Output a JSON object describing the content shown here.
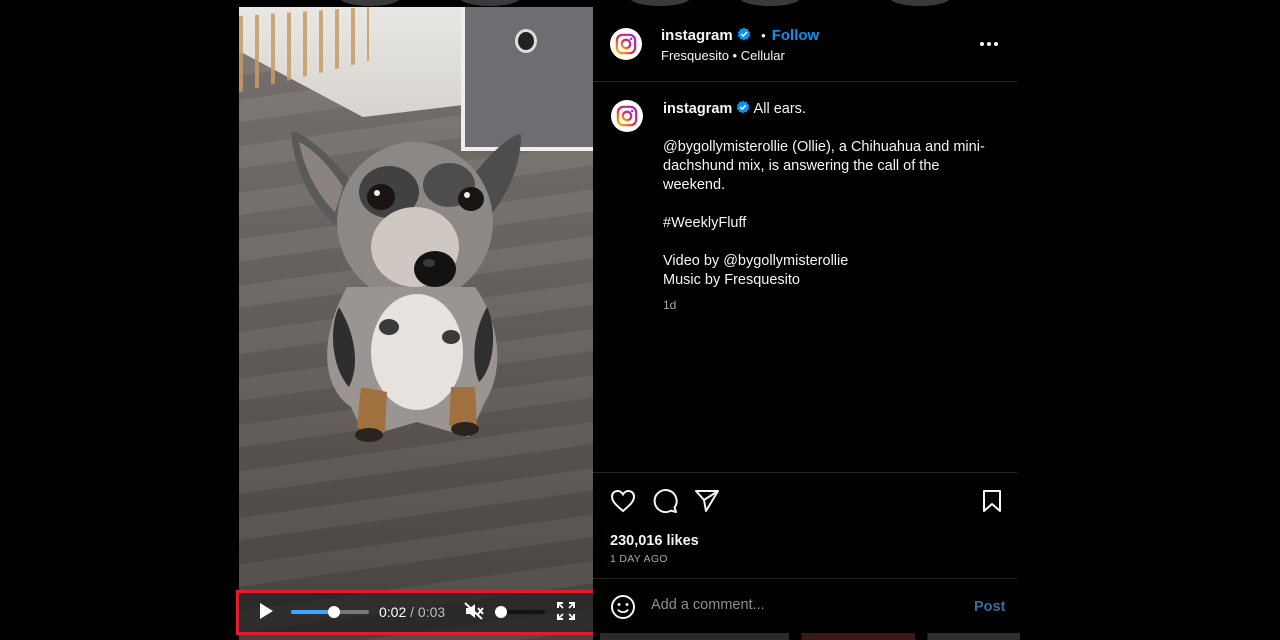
{
  "media": {
    "controls": {
      "current_time": "0:02",
      "separator": " / ",
      "total_time": "0:03",
      "progress_fraction": 0.55,
      "volume_fraction": 0.0,
      "muted": true
    }
  },
  "post": {
    "header": {
      "username": "instagram",
      "follow_label": "Follow",
      "audio_artist": "Fresquesito",
      "audio_separator": "•",
      "audio_track": "Cellular"
    },
    "caption": {
      "username": "instagram",
      "lead": "All ears.",
      "line1": "@bygollymisterollie (Ollie), a Chihuahua and mini-dachshund mix, is answering the call of the weekend.",
      "hashtag": "#WeeklyFluff",
      "credit_video": "Video by @bygollymisterollie",
      "credit_music": "Music by Fresquesito",
      "age_short": "1d"
    },
    "likes": "230,016 likes",
    "age_full": "1 DAY AGO",
    "comment": {
      "placeholder": "Add a comment...",
      "post_label": "Post"
    }
  },
  "colors": {
    "accent_blue": "#0095f6",
    "highlight_red": "#e41b2f",
    "progress_blue": "#3ea6ff",
    "post_button": "#3d6d9c"
  },
  "icons": [
    "instagram-logo-icon",
    "verified-badge-icon",
    "more-options-icon",
    "heart-icon",
    "comment-icon",
    "share-icon",
    "bookmark-icon",
    "emoji-icon",
    "play-icon",
    "muted-volume-icon",
    "fullscreen-icon"
  ]
}
